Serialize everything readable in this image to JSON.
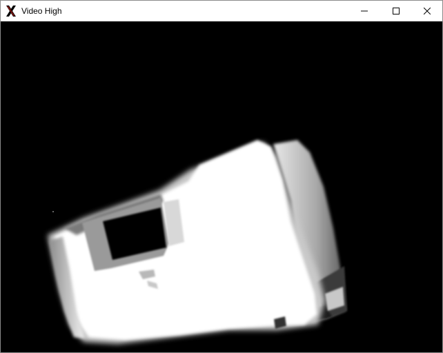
{
  "window": {
    "title": "Video High",
    "icon": "x-app-icon",
    "controls": {
      "minimize_icon": "minimize-icon",
      "maximize_icon": "maximize-icon",
      "close_icon": "close-icon"
    }
  },
  "video": {
    "background_color": "#000000"
  },
  "colors": {
    "titlebar": "#ffffff",
    "title_text": "#000000",
    "window_border": "#8a8a8a",
    "icon_red": "#d9231b",
    "icon_dark": "#000000"
  }
}
